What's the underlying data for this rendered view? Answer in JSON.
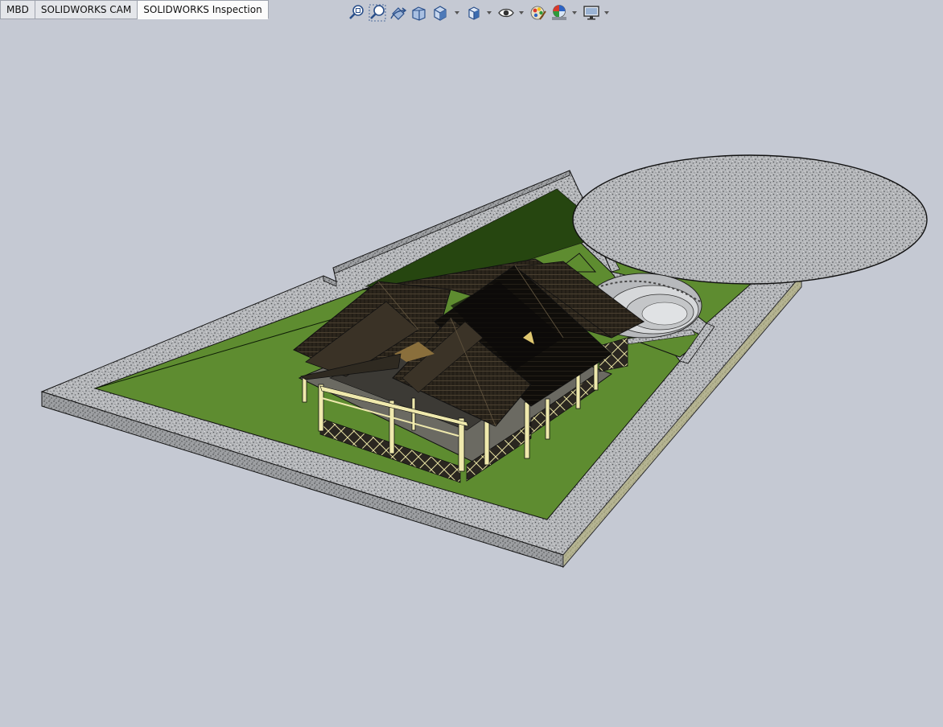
{
  "app": {
    "name": "SOLIDWORKS"
  },
  "tabs": [
    {
      "label": "MBD",
      "active": false
    },
    {
      "label": "SOLIDWORKS CAM",
      "active": false
    },
    {
      "label": "SOLIDWORKS Inspection",
      "active": true
    }
  ],
  "heads_up_toolbar": [
    {
      "icon": "zoom-to-fit-icon",
      "has_dropdown": false
    },
    {
      "icon": "zoom-to-area-icon",
      "has_dropdown": false
    },
    {
      "icon": "previous-view-icon",
      "has_dropdown": false
    },
    {
      "icon": "section-view-icon",
      "has_dropdown": false
    },
    {
      "icon": "view-orientation-icon",
      "has_dropdown": true
    },
    {
      "icon": "display-style-icon",
      "has_dropdown": true
    },
    {
      "icon": "hide-show-items-icon",
      "has_dropdown": true
    },
    {
      "icon": "edit-appearance-icon",
      "has_dropdown": false
    },
    {
      "icon": "apply-scene-icon",
      "has_dropdown": true
    },
    {
      "icon": "view-settings-icon",
      "has_dropdown": true
    }
  ],
  "graphics_area": {
    "background": "#c5c9d3",
    "model": "landscape-with-house",
    "colors": {
      "lawn": "#5e8c30",
      "lawn_dark": "#1f3a0e",
      "gravel": "#b6b8ba",
      "roof": "#2a241b",
      "posts": "#efe9ad"
    }
  }
}
